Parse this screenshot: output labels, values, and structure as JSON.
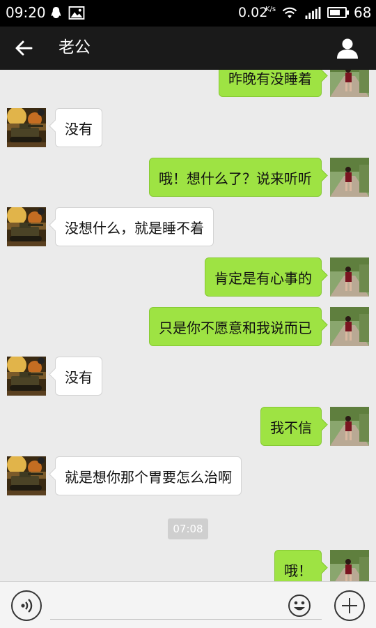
{
  "status_bar": {
    "time": "09:20",
    "network_speed": "0.02",
    "network_speed_unit": "K/s",
    "battery_level": "68",
    "icons": [
      "qq-penguin-icon",
      "image-icon",
      "wifi-icon",
      "signal-icon",
      "battery-icon"
    ]
  },
  "header": {
    "title": "老公",
    "back_icon": "arrow-left-icon",
    "profile_icon": "person-icon"
  },
  "messages": [
    {
      "side": "right",
      "text": "昨晚有没睡着"
    },
    {
      "side": "left",
      "text": "没有"
    },
    {
      "side": "right",
      "text": "哦！想什么了？说来听听"
    },
    {
      "side": "left",
      "text": "没想什么，就是睡不着"
    },
    {
      "side": "right",
      "text": "肯定是有心事的"
    },
    {
      "side": "right",
      "text": "只是你不愿意和我说而已"
    },
    {
      "side": "left",
      "text": "没有"
    },
    {
      "side": "right",
      "text": "我不信"
    },
    {
      "side": "left",
      "text": "就是想你那个胃要怎么治啊"
    },
    {
      "side": "right",
      "text": "哦！"
    }
  ],
  "timestamp": "07:08",
  "input_bar": {
    "placeholder": "",
    "voice_icon": "voice-icon",
    "emoji_icon": "emoji-icon",
    "plus_icon": "plus-icon"
  },
  "colors": {
    "sent_bubble": "#9ee343",
    "received_bubble": "#ffffff",
    "background": "#ebebeb",
    "header": "#1a1a1a"
  }
}
